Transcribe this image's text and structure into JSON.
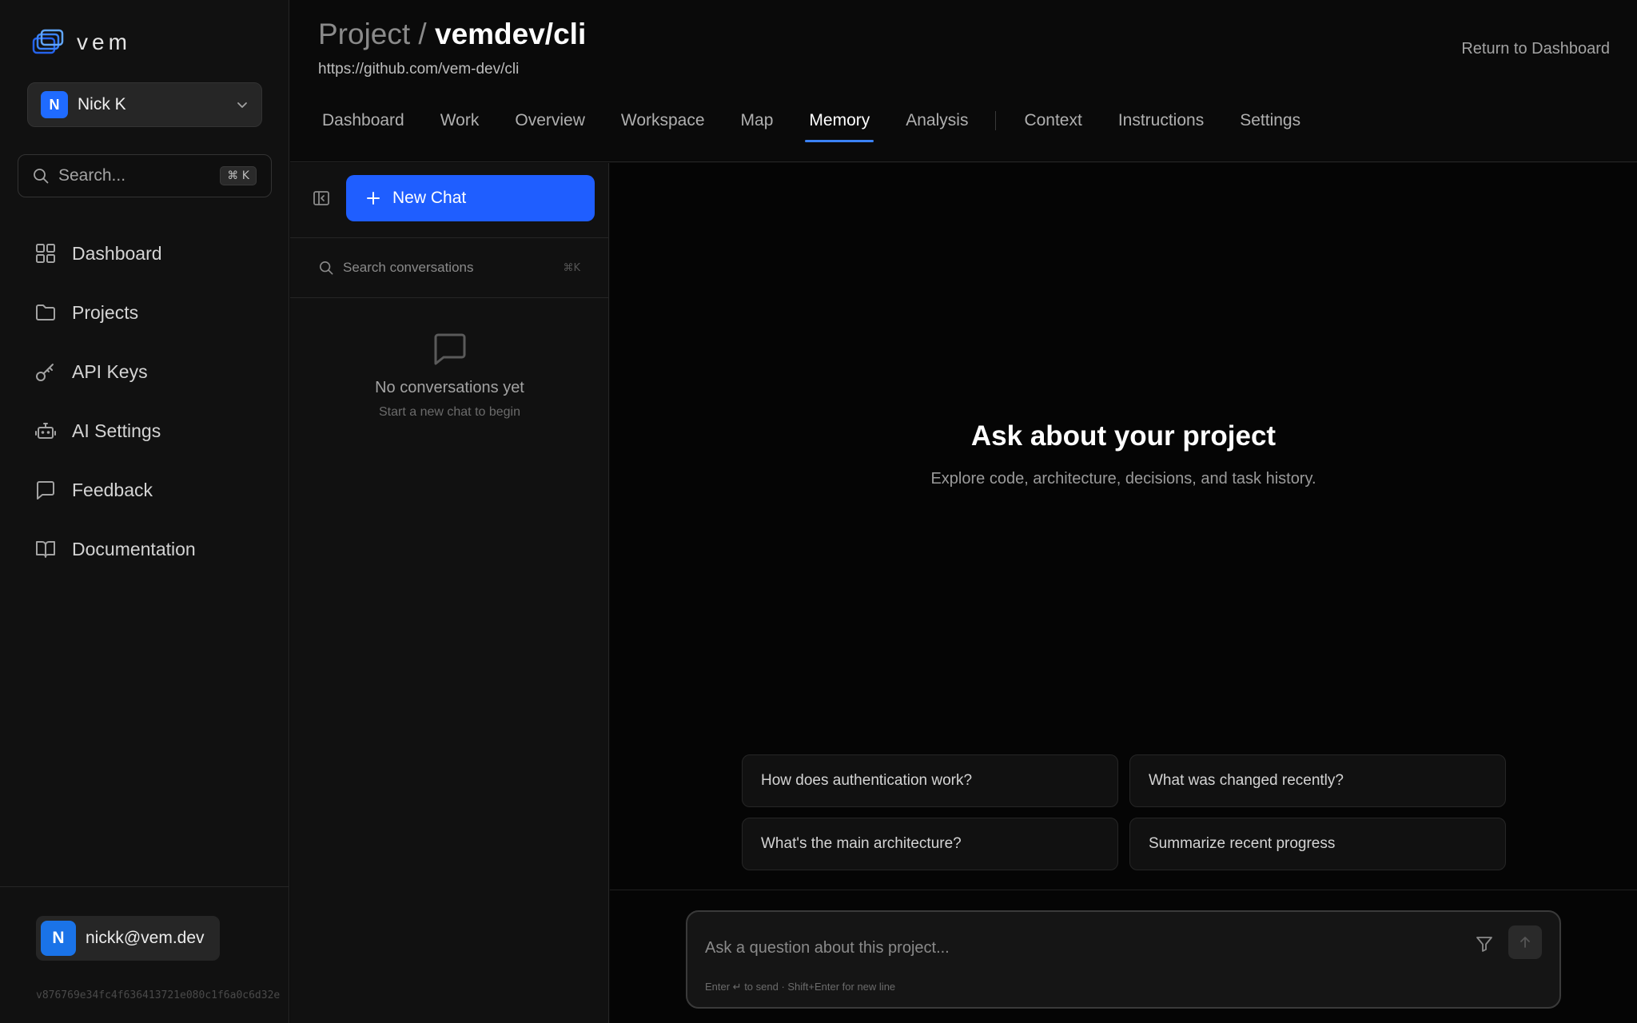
{
  "brand": {
    "name": "vem",
    "logo_icon": "stacked-layers-logo"
  },
  "user_switcher": {
    "initial": "N",
    "name": "Nick K"
  },
  "global_search": {
    "placeholder": "Search...",
    "shortcut": "⌘ K"
  },
  "sidebar": {
    "items": [
      {
        "label": "Dashboard",
        "icon": "grid-icon"
      },
      {
        "label": "Projects",
        "icon": "folder-icon"
      },
      {
        "label": "API Keys",
        "icon": "key-icon"
      },
      {
        "label": "AI Settings",
        "icon": "robot-icon"
      },
      {
        "label": "Feedback",
        "icon": "message-icon"
      },
      {
        "label": "Documentation",
        "icon": "book-icon"
      }
    ]
  },
  "footer": {
    "initial": "N",
    "email": "nickk@vem.dev",
    "version": "v876769e34fc4f636413721e080c1f6a0c6d32e"
  },
  "header": {
    "title_prefix": "Project /",
    "title_name": "vemdev/cli",
    "url": "https://github.com/vem-dev/cli",
    "return_link": "Return to Dashboard",
    "tabs": [
      "Dashboard",
      "Work",
      "Overview",
      "Workspace",
      "Map",
      "Memory",
      "Analysis"
    ],
    "tabs_secondary": [
      "Context",
      "Instructions",
      "Settings"
    ],
    "active_tab": "Memory"
  },
  "conversations": {
    "new_chat_label": "New Chat",
    "search_placeholder": "Search conversations",
    "search_shortcut": "⌘K",
    "empty_title": "No conversations yet",
    "empty_subtitle": "Start a new chat to begin"
  },
  "chat": {
    "title": "Ask about your project",
    "subtitle": "Explore code, architecture, decisions, and task history.",
    "suggestions": [
      "How does authentication work?",
      "What was changed recently?",
      "What's the main architecture?",
      "Summarize recent progress"
    ],
    "input_placeholder": "Ask a question about this project...",
    "input_help": "Enter ↵ to send · Shift+Enter for new line"
  },
  "colors": {
    "accent": "#1f5eff",
    "tab_underline": "#3b82f6",
    "background": "#0a0a0a"
  }
}
